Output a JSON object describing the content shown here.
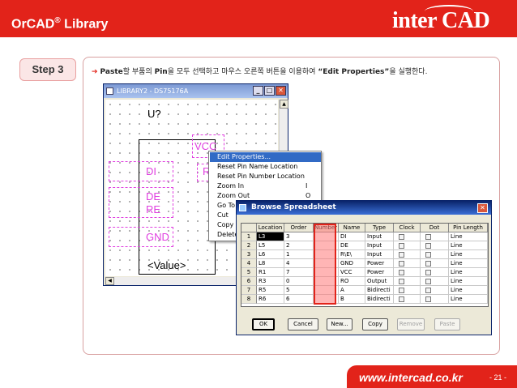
{
  "header": {
    "title": "OrCAD",
    "title_reg": "®",
    "title_suffix": " Library",
    "logo": "inter CAD"
  },
  "step": {
    "label": "Step 3"
  },
  "instruction": {
    "arrow": "➔",
    "b1": "Paste",
    "t1": "할 부품의 ",
    "b2": "Pin",
    "t2": "을 모두 선택하고 마우스 오른쪽 버튼을 이용하여 ",
    "b3": "“Edit Properties”",
    "t3": "을 실행한다."
  },
  "library_window": {
    "title": "LIBRARY2 - DS75176A",
    "min": "_",
    "max": "□",
    "close": "✕",
    "scroll_up": "▲",
    "scroll_left": "◀",
    "part_ref": "U?",
    "part_value": "<Value>",
    "pins": [
      "VCC",
      "DI",
      "DE",
      "RE",
      "GND",
      "R"
    ]
  },
  "context_menu": {
    "items": [
      {
        "label": "Edit Properties...",
        "key": ""
      },
      {
        "label": "Reset Pin Name Location",
        "key": ""
      },
      {
        "label": "Reset Pin Number Location",
        "key": ""
      },
      {
        "label": "Zoom In",
        "key": "I"
      },
      {
        "label": "Zoom Out",
        "key": "O"
      },
      {
        "label": "Go To",
        "key": ""
      },
      {
        "label": "Cut",
        "key": ""
      },
      {
        "label": "Copy",
        "key": ""
      },
      {
        "label": "Delete",
        "key": ""
      }
    ]
  },
  "spreadsheet": {
    "title": "Browse Spreadsheet",
    "close": "✕",
    "columns": [
      "Location",
      "Order",
      "Number",
      "Name",
      "Type",
      "Clock",
      "Dot",
      "Pin Length"
    ],
    "rows": [
      {
        "n": "1",
        "location": "L3",
        "order": "3",
        "number": "",
        "name": "DI",
        "type": "Input",
        "length": "Line"
      },
      {
        "n": "2",
        "location": "L5",
        "order": "2",
        "number": "",
        "name": "DE",
        "type": "Input",
        "length": "Line"
      },
      {
        "n": "3",
        "location": "L6",
        "order": "1",
        "number": "",
        "name": "R\\E\\",
        "type": "Input",
        "length": "Line"
      },
      {
        "n": "4",
        "location": "L8",
        "order": "4",
        "number": "",
        "name": "GND",
        "type": "Power",
        "length": "Line"
      },
      {
        "n": "5",
        "location": "R1",
        "order": "7",
        "number": "",
        "name": "VCC",
        "type": "Power",
        "length": "Line"
      },
      {
        "n": "6",
        "location": "R3",
        "order": "0",
        "number": "",
        "name": "RO",
        "type": "Output",
        "length": "Line"
      },
      {
        "n": "7",
        "location": "R5",
        "order": "5",
        "number": "",
        "name": "A",
        "type": "Bidirecti",
        "length": "Line"
      },
      {
        "n": "8",
        "location": "R6",
        "order": "6",
        "number": "",
        "name": "B",
        "type": "Bidirecti",
        "length": "Line"
      }
    ],
    "buttons": [
      {
        "label": "OK",
        "enabled": true
      },
      {
        "label": "Cancel",
        "enabled": true
      },
      {
        "label": "New...",
        "enabled": true
      },
      {
        "label": "Copy",
        "enabled": true
      },
      {
        "label": "Remove",
        "enabled": false
      },
      {
        "label": "Paste",
        "enabled": false
      }
    ]
  },
  "footer": {
    "url": "www.intercad.co.kr",
    "page": "- 21 -"
  },
  "colors": {
    "brand_red": "#e2231a",
    "pin_magenta": "#e040e0",
    "menu_highlight": "#316ac5"
  }
}
